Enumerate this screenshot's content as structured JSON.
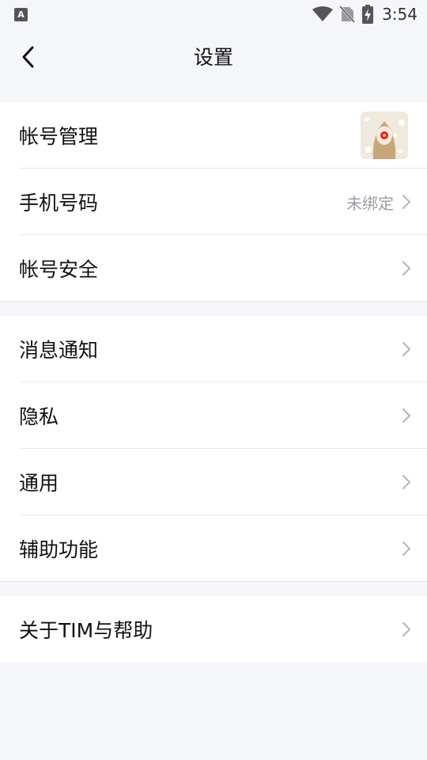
{
  "status_bar": {
    "time": "3:54",
    "left_icon_letter": "A",
    "icons": [
      "app-notification-icon",
      "wifi-icon",
      "no-sim-icon",
      "battery-charging-icon"
    ]
  },
  "header": {
    "title": "设置",
    "back_icon": "chevron-left-icon"
  },
  "groups": [
    {
      "items": [
        {
          "label": "帐号管理",
          "value": "",
          "trailing": "avatar"
        },
        {
          "label": "手机号码",
          "value": "未绑定",
          "trailing": "chevron"
        },
        {
          "label": "帐号安全",
          "value": "",
          "trailing": "chevron"
        }
      ]
    },
    {
      "items": [
        {
          "label": "消息通知",
          "trailing": "chevron"
        },
        {
          "label": "隐私",
          "trailing": "chevron"
        },
        {
          "label": "通用",
          "trailing": "chevron"
        },
        {
          "label": "辅助功能",
          "trailing": "chevron"
        }
      ]
    },
    {
      "items": [
        {
          "label": "关于TIM与帮助",
          "trailing": "chevron"
        }
      ]
    }
  ],
  "colors": {
    "background": "#f5f6fa",
    "card": "#ffffff",
    "secondary_text": "#9b9ca3",
    "chevron": "#b7b8bd"
  }
}
